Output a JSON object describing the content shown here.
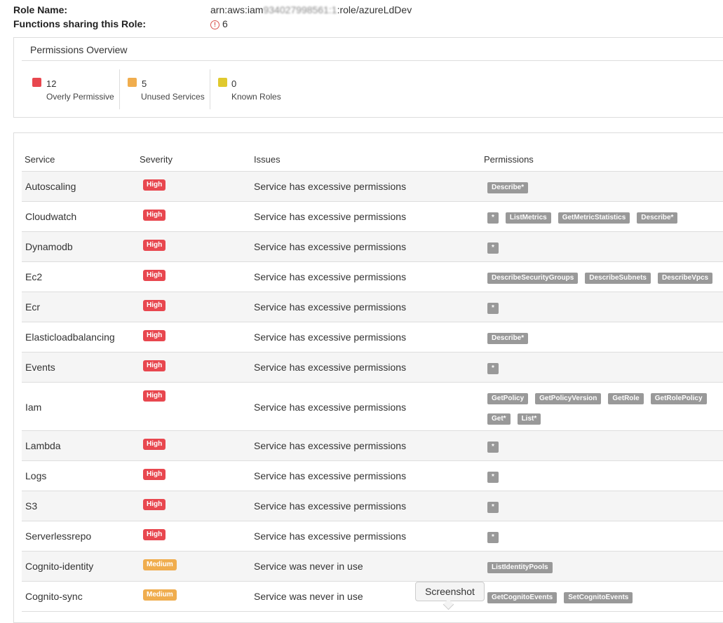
{
  "role": {
    "name_label": "Role Name:",
    "arn_prefix": "arn:aws:iam",
    "arn_account": "934027998561:1",
    "arn_suffix": ":role/azureLdDev",
    "functions_label": "Functions sharing this Role:",
    "functions_count": "6"
  },
  "overview": {
    "title": "Permissions Overview",
    "stats": [
      {
        "value": "12",
        "label": "Overly Permissive",
        "color": "#e8474f"
      },
      {
        "value": "5",
        "label": "Unused Services",
        "color": "#f0ad4e"
      },
      {
        "value": "0",
        "label": "Known Roles",
        "color": "#e0c92e"
      }
    ]
  },
  "table": {
    "columns": [
      "Service",
      "Severity",
      "Issues",
      "Permissions"
    ],
    "severity_colors": {
      "High": "#e8474f",
      "Medium": "#f0ad4e"
    },
    "rows": [
      {
        "service": "Autoscaling",
        "severity": "High",
        "issue": "Service has excessive permissions",
        "permissions": [
          "Describe*"
        ]
      },
      {
        "service": "Cloudwatch",
        "severity": "High",
        "issue": "Service has excessive permissions",
        "permissions": [
          "*",
          "ListMetrics",
          "GetMetricStatistics",
          "Describe*"
        ]
      },
      {
        "service": "Dynamodb",
        "severity": "High",
        "issue": "Service has excessive permissions",
        "permissions": [
          "*"
        ]
      },
      {
        "service": "Ec2",
        "severity": "High",
        "issue": "Service has excessive permissions",
        "permissions": [
          "DescribeSecurityGroups",
          "DescribeSubnets",
          "DescribeVpcs"
        ]
      },
      {
        "service": "Ecr",
        "severity": "High",
        "issue": "Service has excessive permissions",
        "permissions": [
          "*"
        ]
      },
      {
        "service": "Elasticloadbalancing",
        "severity": "High",
        "issue": "Service has excessive permissions",
        "permissions": [
          "Describe*"
        ]
      },
      {
        "service": "Events",
        "severity": "High",
        "issue": "Service has excessive permissions",
        "permissions": [
          "*"
        ]
      },
      {
        "service": "Iam",
        "severity": "High",
        "issue": "Service has excessive permissions",
        "permissions": [
          "GetPolicy",
          "GetPolicyVersion",
          "GetRole",
          "GetRolePolicy",
          "Get*",
          "List*"
        ]
      },
      {
        "service": "Lambda",
        "severity": "High",
        "issue": "Service has excessive permissions",
        "permissions": [
          "*"
        ]
      },
      {
        "service": "Logs",
        "severity": "High",
        "issue": "Service has excessive permissions",
        "permissions": [
          "*"
        ]
      },
      {
        "service": "S3",
        "severity": "High",
        "issue": "Service has excessive permissions",
        "permissions": [
          "*"
        ]
      },
      {
        "service": "Serverlessrepo",
        "severity": "High",
        "issue": "Service has excessive permissions",
        "permissions": [
          "*"
        ]
      },
      {
        "service": "Cognito-identity",
        "severity": "Medium",
        "issue": "Service was never in use",
        "permissions": [
          "ListIdentityPools"
        ]
      },
      {
        "service": "Cognito-sync",
        "severity": "Medium",
        "issue": "Service was never in use",
        "permissions": [
          "GetCognitoEvents",
          "SetCognitoEvents"
        ]
      }
    ]
  },
  "tooltip": {
    "text": "Screenshot"
  }
}
